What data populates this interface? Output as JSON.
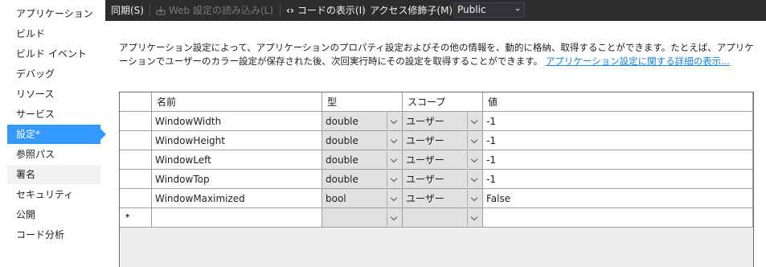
{
  "sidebar": {
    "items": [
      {
        "label": "アプリケーション"
      },
      {
        "label": "ビルド"
      },
      {
        "label": "ビルド イベント"
      },
      {
        "label": "デバッグ"
      },
      {
        "label": "リソース"
      },
      {
        "label": "サービス"
      },
      {
        "label": "設定*"
      },
      {
        "label": "参照パス"
      },
      {
        "label": "署名"
      },
      {
        "label": "セキュリティ"
      },
      {
        "label": "公開"
      },
      {
        "label": "コード分析"
      }
    ],
    "active_index": 6
  },
  "toolbar": {
    "sync_label": "同期(S)",
    "load_web_label": "Web 設定の読み込み(L)",
    "view_code_label": "コードの表示(I)",
    "access_label": "アクセス修飾子(M):",
    "access_value": "Public"
  },
  "description": {
    "text": "アプリケーション設定によって、アプリケーションのプロパティ設定およびその他の情報を、動的に格納、取得することができます。たとえば、アプリケーションでユーザーのカラー設定が保存された後、次回実行時にその設定を取得することができます。",
    "link": "アプリケーション設定に関する詳細の表示..."
  },
  "grid": {
    "headers": {
      "name": "名前",
      "type": "型",
      "scope": "スコープ",
      "value": "値"
    },
    "rows": [
      {
        "name": "WindowWidth",
        "type": "double",
        "scope": "ユーザー",
        "value": "-1"
      },
      {
        "name": "WindowHeight",
        "type": "double",
        "scope": "ユーザー",
        "value": "-1"
      },
      {
        "name": "WindowLeft",
        "type": "double",
        "scope": "ユーザー",
        "value": "-1"
      },
      {
        "name": "WindowTop",
        "type": "double",
        "scope": "ユーザー",
        "value": "-1"
      },
      {
        "name": "WindowMaximized",
        "type": "bool",
        "scope": "ユーザー",
        "value": "False"
      }
    ],
    "new_row_marker": "*"
  },
  "colors": {
    "toolbar_bg": "#2d2d30",
    "active_item_bg": "#3399ff",
    "link": "#1a7fd6"
  }
}
